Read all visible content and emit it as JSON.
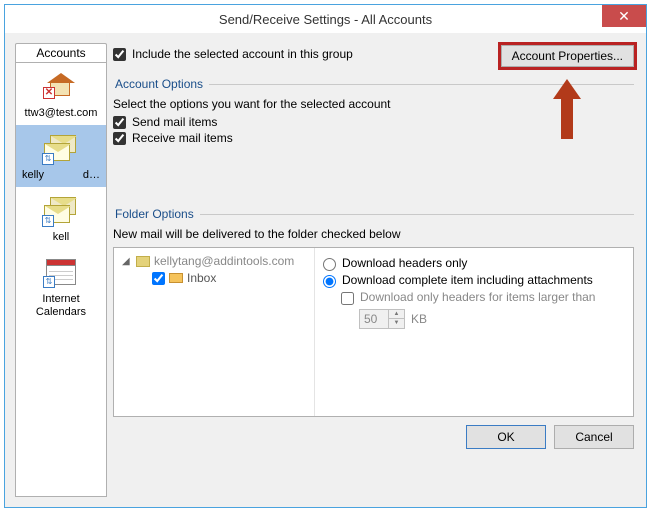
{
  "window": {
    "title": "Send/Receive Settings - All Accounts"
  },
  "sidebar": {
    "header": "Accounts",
    "items": [
      {
        "label": "ttw3@test.com"
      },
      {
        "label_left": "kelly",
        "label_right": "d…"
      },
      {
        "label": "kell"
      },
      {
        "label": "Internet Calendars"
      }
    ]
  },
  "top": {
    "include_label": "Include the selected account in this group",
    "account_properties_btn": "Account Properties..."
  },
  "account_options": {
    "legend": "Account Options",
    "desc": "Select the options you want for the selected account",
    "send_label": "Send mail items",
    "receive_label": "Receive mail items"
  },
  "folder_options": {
    "legend": "Folder Options",
    "desc": "New mail will be delivered to the folder checked below",
    "tree": {
      "root": "kellytang@addintools.com",
      "inbox": "Inbox"
    },
    "download": {
      "headers_only": "Download headers only",
      "complete": "Download complete item including attachments",
      "headers_larger": "Download only headers for items larger than",
      "size_value": "50",
      "size_unit": "KB"
    }
  },
  "footer": {
    "ok": "OK",
    "cancel": "Cancel"
  }
}
